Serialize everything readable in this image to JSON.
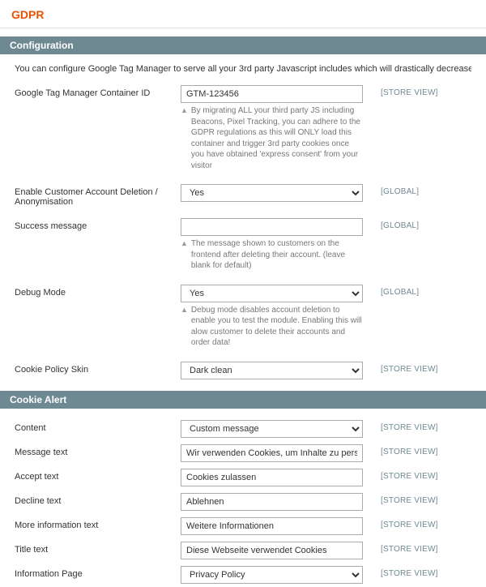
{
  "page": {
    "title": "GDPR"
  },
  "scopes": {
    "store_view": "[STORE VIEW]",
    "global": "[GLOBAL]"
  },
  "configuration": {
    "header": "Configuration",
    "intro": "You can configure Google Tag Manager to serve all your 3rd party Javascript includes which will drastically decrease the comple",
    "gtm": {
      "label": "Google Tag Manager Container ID",
      "value": "GTM-123456",
      "hint": "By migrating ALL your third party JS including Beacons, Pixel Tracking, you can adhere to the GDPR regulations as this will ONLY load this container and trigger 3rd party cookies once you have obtained 'express consent' from your visitor"
    },
    "enable_deletion": {
      "label": "Enable Customer Account Deletion / Anonymisation",
      "value": "Yes"
    },
    "success_message": {
      "label": "Success message",
      "value": "",
      "hint": "The message shown to customers on the frontend after deleting their account. (leave blank for default)"
    },
    "debug_mode": {
      "label": "Debug Mode",
      "value": "Yes",
      "hint": "Debug mode disables account deletion to enable you to test the module. Enabling this will alow customer to delete their accounts and order data!"
    },
    "cookie_policy_skin": {
      "label": "Cookie Policy Skin",
      "value": "Dark clean"
    }
  },
  "cookie_alert": {
    "header": "Cookie Alert",
    "content": {
      "label": "Content",
      "value": "Custom message"
    },
    "message_text": {
      "label": "Message text",
      "value": "Wir verwenden Cookies, um Inhalte zu personalisie"
    },
    "accept_text": {
      "label": "Accept text",
      "value": "Cookies zulassen"
    },
    "decline_text": {
      "label": "Decline text",
      "value": "Ablehnen"
    },
    "more_info_text": {
      "label": "More information text",
      "value": "Weitere Informationen"
    },
    "title_text": {
      "label": "Title text",
      "value": "Diese Webseite verwendet Cookies"
    },
    "information_page": {
      "label": "Information Page",
      "value": "Privacy Policy"
    }
  }
}
